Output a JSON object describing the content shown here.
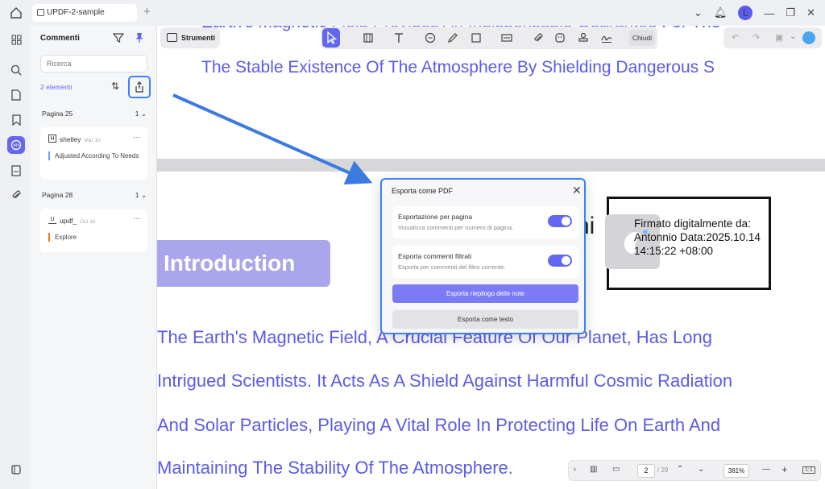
{
  "window": {
    "tab_title": "UPDF-2-sample",
    "avatar_letter": "L"
  },
  "toolbar": {
    "tools_label": "Strumenti",
    "close_label": "Chiudi"
  },
  "comments_panel": {
    "title": "Commenti",
    "search_placeholder": "Ricerca",
    "count_label": "2 elementi",
    "groups": [
      {
        "page": "Pagina 25",
        "count": "1",
        "author": "shelley",
        "date": "Mar 10",
        "text": "Adjusted According To Needs",
        "accent": "#60a5fa"
      },
      {
        "page": "Pagina 28",
        "count": "1",
        "author": "updf_",
        "date": "Oct 16",
        "text": "Explore",
        "accent": "#f97316"
      }
    ]
  },
  "document": {
    "top_partial": "Earth's Magnetic Field Provides An Indispensable Guarantee For The",
    "line_top": "The Stable Existence Of The Atmosphere By Shielding Dangerous S",
    "intro_heading": "Introduction",
    "sig_letters": "ni",
    "signature": "Firmato digitalmente da: Antonnio Data:2025.10.14 14:15:22 +08:00",
    "body_lines": [
      "The Earth's Magnetic Field, A Crucial Feature Of Our Planet, Has Long",
      "Intrigued Scientists. It Acts As A Shield Against Harmful Cosmic Radiation",
      "And Solar Particles, Playing A Vital Role In Protecting Life On Earth And",
      "Maintaining The Stability Of The Atmosphere."
    ]
  },
  "dialog": {
    "title": "Esporta come PDF",
    "option1_title": "Esportazione per pagina",
    "option1_sub": "Visualizza commenti per numero di pagina.",
    "option2_title": "Esporta commenti filtrati",
    "option2_sub": "Esporta per commenti del filtro corrente.",
    "primary_button": "Esporta riepilogo delle note",
    "secondary_button": "Esporta come testo"
  },
  "bottombar": {
    "page": "2",
    "total": "/ 29",
    "zoom": "381%",
    "fit": "1:1"
  },
  "colors": {
    "accent": "#6366f1",
    "doc_text": "#5b5be8",
    "highlight": "#3b82f6"
  }
}
